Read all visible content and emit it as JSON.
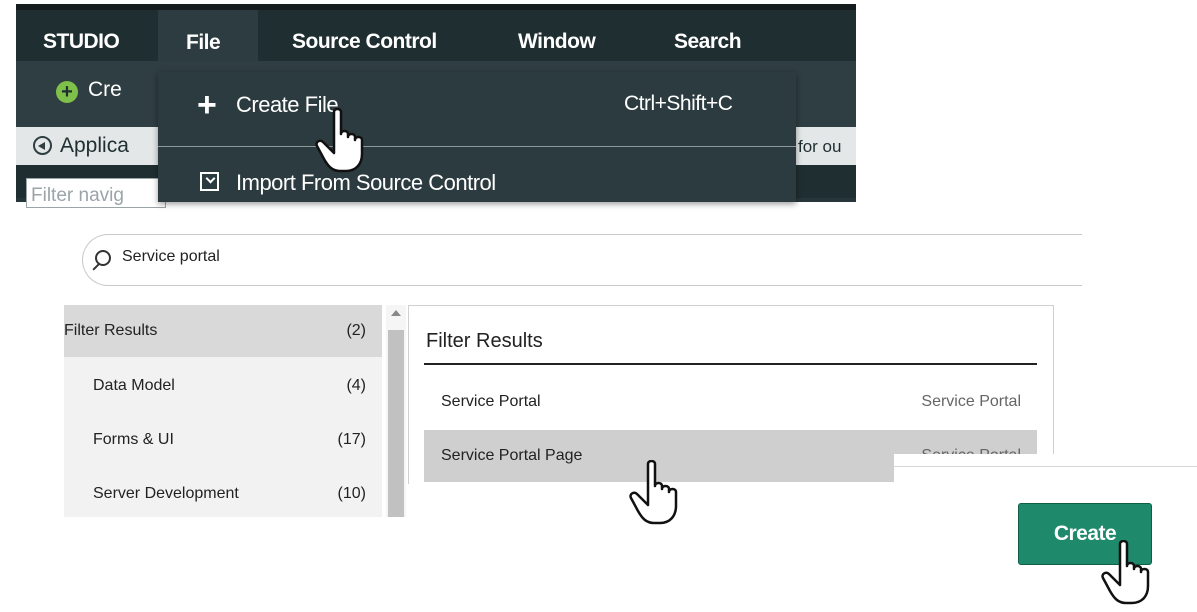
{
  "studio": {
    "menu": [
      "STUDIO",
      "File",
      "Source Control",
      "Window",
      "Search"
    ],
    "toolbar_create_stub": "Cre",
    "app_stub": "Applica",
    "right_stub": "for ou",
    "filter_placeholder": "Filter navig"
  },
  "file_menu": {
    "create_label": "Create File",
    "create_shortcut": "Ctrl+Shift+C",
    "import_label": "Import From Source Control"
  },
  "search": {
    "value": "Service portal"
  },
  "sidebar": {
    "header": {
      "label": "Filter Results",
      "count": "(2)"
    },
    "items": [
      {
        "label": "Data Model",
        "count": "(4)"
      },
      {
        "label": "Forms & UI",
        "count": "(17)"
      },
      {
        "label": "Server Development",
        "count": "(10)"
      }
    ]
  },
  "results": {
    "heading": "Filter Results",
    "rows": [
      {
        "name": "Service Portal",
        "type": "Service Portal"
      },
      {
        "name": "Service Portal Page",
        "type": "Service Portal"
      }
    ]
  },
  "dialog": {
    "create_button": "Create"
  }
}
